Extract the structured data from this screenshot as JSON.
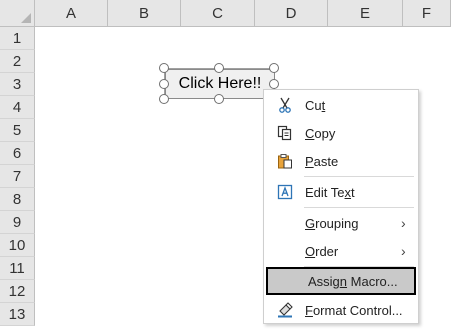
{
  "columns": [
    "A",
    "B",
    "C",
    "D",
    "E",
    "F"
  ],
  "rows": [
    "1",
    "2",
    "3",
    "4",
    "5",
    "6",
    "7",
    "8",
    "9",
    "10",
    "11",
    "12",
    "13"
  ],
  "form_button": {
    "label": "Click Here!!"
  },
  "context_menu": {
    "cut": {
      "pre": "Cu",
      "key": "t",
      "post": ""
    },
    "copy": {
      "pre": "",
      "key": "C",
      "post": "opy"
    },
    "paste": {
      "pre": "",
      "key": "P",
      "post": "aste"
    },
    "edit_text": {
      "pre": "Edit Te",
      "key": "x",
      "post": "t"
    },
    "grouping": {
      "pre": "",
      "key": "G",
      "post": "rouping"
    },
    "order": {
      "pre": "",
      "key": "O",
      "post": "rder"
    },
    "assign_macro": {
      "pre": "Assig",
      "key": "n",
      "post": " Macro..."
    },
    "format_control": {
      "pre": "",
      "key": "F",
      "post": "ormat Control..."
    },
    "submenu_arrow": "›"
  },
  "icons": {
    "cut": "scissors-icon",
    "copy": "copy-icon",
    "paste": "paste-icon",
    "edit_text": "edit-text-icon",
    "format_control": "format-control-icon"
  },
  "colors": {
    "header_bg": "#e6e6e6",
    "highlight_bg": "#c9c9c9",
    "highlight_border": "#000000",
    "icon_blue": "#2e75b6",
    "icon_orange": "#d68a1a"
  }
}
